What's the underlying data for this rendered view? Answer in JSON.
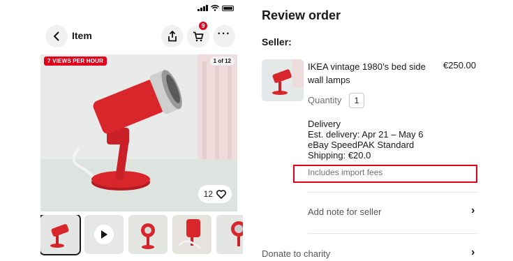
{
  "item_view": {
    "header": {
      "back_label": "Item",
      "cart_count": "9",
      "more_label": "···"
    },
    "gallery": {
      "views_badge": "7 VIEWS PER HOUR",
      "image_counter": "1 of 12",
      "like_count": "12"
    },
    "thumbnails": [
      {
        "kind": "image"
      },
      {
        "kind": "video"
      },
      {
        "kind": "image"
      },
      {
        "kind": "image"
      },
      {
        "kind": "image"
      }
    ]
  },
  "review_order": {
    "title": "Review order",
    "seller_label": "Seller:",
    "product": {
      "name": "IKEA vintage 1980’s bed side wall lamps",
      "price": "€250.00",
      "quantity_label": "Quantity",
      "quantity": "1"
    },
    "delivery": {
      "heading": "Delivery",
      "est_delivery": "Est. delivery: Apr 21 – May 6",
      "service": "eBay SpeedPAK Standard",
      "shipping": "Shipping: €20.0",
      "import_fees": "Includes import fees"
    },
    "add_note_label": "Add note for seller",
    "donate_label": "Donate to charity"
  },
  "colors": {
    "accent_red": "#e0001b",
    "lamp_red": "#d9262b",
    "text": "#191919",
    "muted": "#707070"
  },
  "icons": [
    "back-icon",
    "share-icon",
    "cart-icon",
    "more-icon",
    "heart-icon",
    "play-icon",
    "chevron-right-icon"
  ]
}
